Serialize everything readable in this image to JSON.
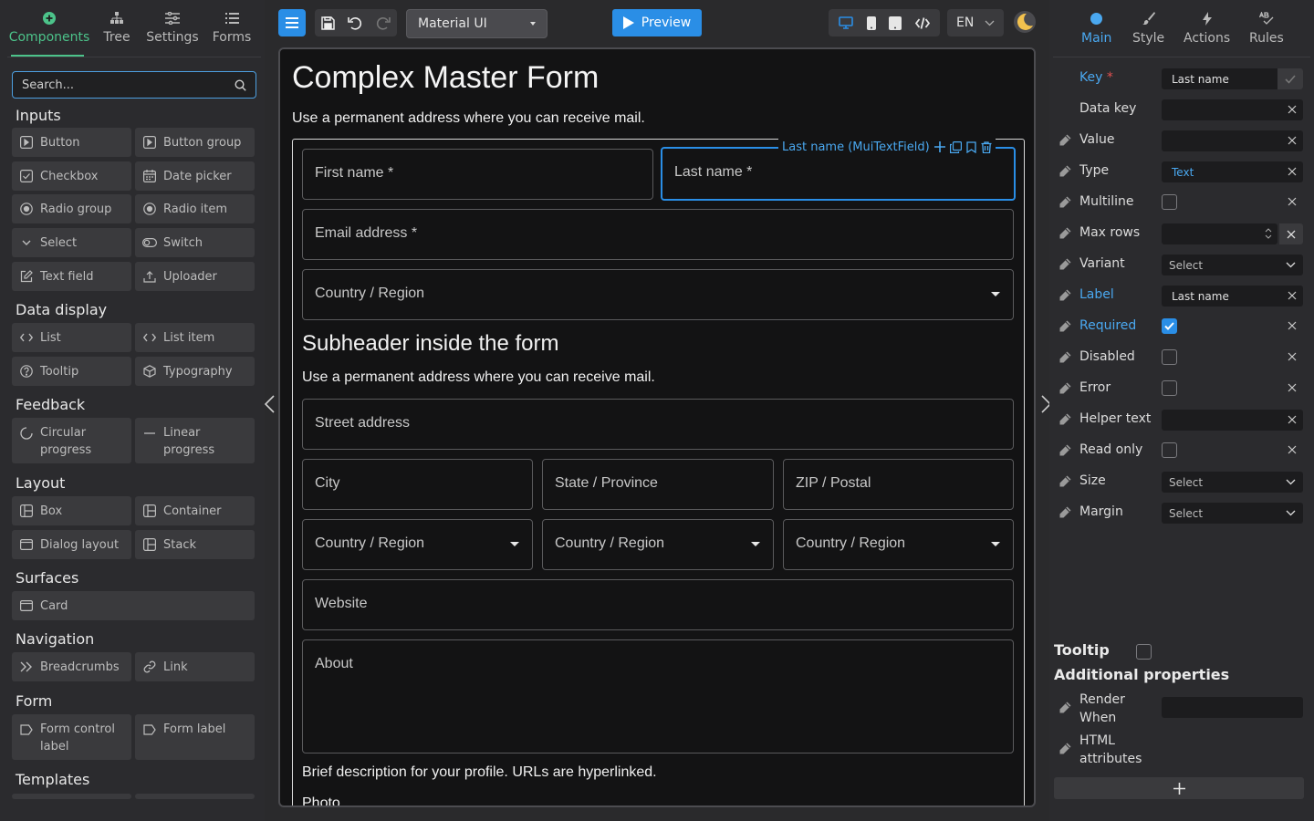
{
  "left_tabs": [
    {
      "label": "Components",
      "icon": "plus-circle-icon"
    },
    {
      "label": "Tree",
      "icon": "tree-icon"
    },
    {
      "label": "Settings",
      "icon": "sliders-icon"
    },
    {
      "label": "Forms",
      "icon": "list-icon"
    }
  ],
  "search": {
    "placeholder": "Search..."
  },
  "sections": {
    "inputs": "Inputs",
    "data_display": "Data display",
    "feedback": "Feedback",
    "layout": "Layout",
    "surfaces": "Surfaces",
    "navigation": "Navigation",
    "form": "Form",
    "templates": "Templates"
  },
  "components": {
    "button": "Button",
    "button_group": "Button group",
    "checkbox": "Checkbox",
    "date_picker": "Date picker",
    "radio_group": "Radio group",
    "radio_item": "Radio item",
    "select": "Select",
    "switch": "Switch",
    "text_field": "Text field",
    "uploader": "Uploader",
    "list": "List",
    "list_item": "List item",
    "tooltip": "Tooltip",
    "typography": "Typography",
    "circular_progress_1": "Circular",
    "circular_progress_2": "progress",
    "linear_progress_1": "Linear",
    "linear_progress_2": "progress",
    "box": "Box",
    "container": "Container",
    "dialog_layout": "Dialog layout",
    "stack": "Stack",
    "card": "Card",
    "breadcrumbs": "Breadcrumbs",
    "link": "Link",
    "form_control_label_1": "Form control",
    "form_control_label_2": "label",
    "form_label": "Form label"
  },
  "toolbar": {
    "library": "Material UI",
    "preview": "Preview",
    "language": "EN"
  },
  "form": {
    "title": "Complex Master Form",
    "subtitle": "Use a permanent address where you can receive mail.",
    "first_name": "First name *",
    "last_name": "Last name *",
    "selected_tag": "Last name (MuiTextField)",
    "email": "Email address *",
    "country": "Country / Region",
    "subheader": "Subheader inside the form",
    "subheader_text": "Use a permanent address where you can receive mail.",
    "street": "Street address",
    "city": "City",
    "state": "State / Province",
    "zip": "ZIP / Postal",
    "country_a": "Country / Region",
    "country_b": "Country / Region",
    "country_c": "Country / Region",
    "website": "Website",
    "about": "About",
    "about_helper": "Brief description for your profile. URLs are hyperlinked.",
    "photo": "Photo"
  },
  "right_tabs": [
    {
      "label": "Main",
      "icon": "dot-icon"
    },
    {
      "label": "Style",
      "icon": "brush-icon"
    },
    {
      "label": "Actions",
      "icon": "bolt-icon"
    },
    {
      "label": "Rules",
      "icon": "rules-icon"
    }
  ],
  "props": {
    "key_label": "Key",
    "key_value": "Last name",
    "data_key": "Data key",
    "value": "Value",
    "type": "Type",
    "type_value": "Text",
    "multiline": "Multiline",
    "max_rows": "Max rows",
    "variant": "Variant",
    "variant_value": "Select",
    "label": "Label",
    "label_value": "Last name",
    "required": "Required",
    "disabled": "Disabled",
    "error": "Error",
    "helper_text": "Helper text",
    "read_only": "Read only",
    "size": "Size",
    "size_value": "Select",
    "margin": "Margin",
    "margin_value": "Select",
    "tooltip": "Tooltip",
    "additional": "Additional properties",
    "render_when_1": "Render",
    "render_when_2": "When",
    "html_attr_1": "HTML",
    "html_attr_2": "attributes"
  },
  "colors": {
    "accent_green": "#4cc38a",
    "accent_blue": "#2a8ee6"
  }
}
